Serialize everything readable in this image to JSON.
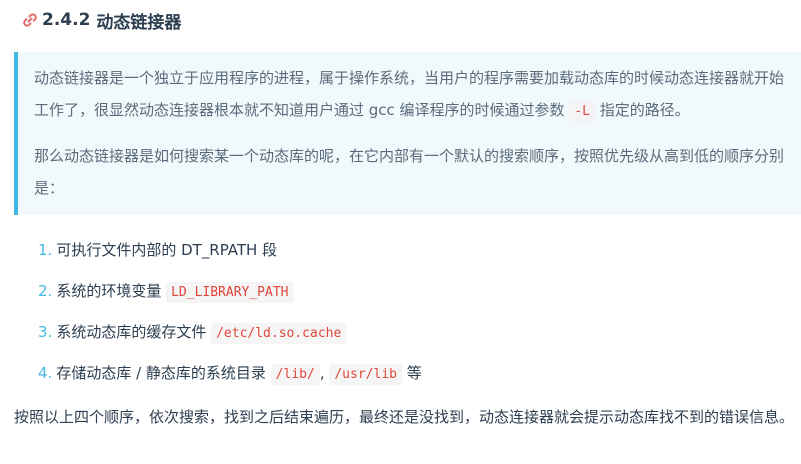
{
  "heading": {
    "number": "2.4.2",
    "title": "动态链接器"
  },
  "quote": {
    "p1_text": "动态链接器是一个独立于应用程序的进程，属于操作系统，当用户的程序需要加载动态库的时候动态连接器就开始工作了，很显然动态连接器根本就不知道用户通过 gcc 编译程序的时候通过参数 ",
    "p1_code": "-L",
    "p1_tail": " 指定的路径。",
    "p2_text": "那么动态链接器是如何搜索某一个动态库的呢，在它内部有一个默认的搜索顺序，按照优先级从高到低的顺序分别是："
  },
  "list": {
    "item1": {
      "num": "1.",
      "text": "可执行文件内部的 DT_RPATH 段"
    },
    "item2": {
      "num": "2.",
      "text": "系统的环境变量 ",
      "code": "LD_LIBRARY_PATH"
    },
    "item3": {
      "num": "3.",
      "text": "系统动态库的缓存文件 ",
      "code": "/etc/ld.so.cache"
    },
    "item4": {
      "num": "4.",
      "text": "存储动态库 / 静态库的系统目录 ",
      "code1": "/lib/",
      "sep": ", ",
      "code2": "/usr/lib",
      "tail": " 等"
    }
  },
  "closing": "按照以上四个顺序，依次搜索，找到之后结束遍历，最终还是没找到，动态连接器就会提示动态库找不到的错误信息。",
  "icons": {
    "heading_anchor": "link-icon"
  },
  "colors": {
    "accent": "#42b9e2",
    "code_text": "#e0463b",
    "quote_bg": "#f1f9fc",
    "link_icon": "#e26b6b"
  }
}
